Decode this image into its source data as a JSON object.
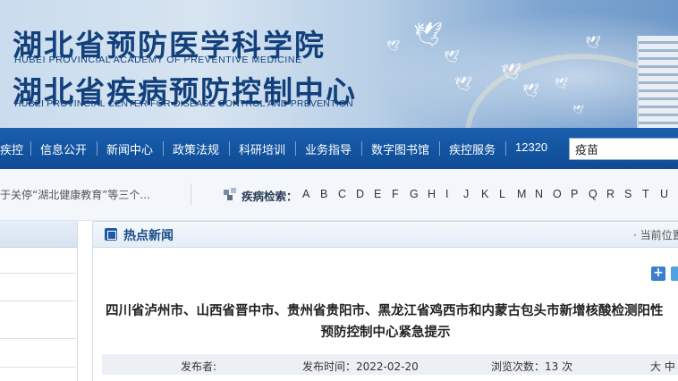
{
  "header": {
    "title_cn_1": "湖北省预防医学科学院",
    "title_en_1": "HUBEI PROVINCIAL ACADEMY OF PREVENTIVE MEDICINE",
    "title_cn_2": "湖北省疾病预防控制中心",
    "title_en_2": "HUBEI PROVINCIAL CENTER FOR DISEASE CONTROL AND PREVENTION"
  },
  "nav": {
    "items": [
      {
        "label": "疾控"
      },
      {
        "label": "信息公开"
      },
      {
        "label": "新闻中心"
      },
      {
        "label": "政策法规"
      },
      {
        "label": "科研培训"
      },
      {
        "label": "业务指导"
      },
      {
        "label": "数字图书馆"
      },
      {
        "label": "疾控服务"
      },
      {
        "label": "12320"
      }
    ],
    "search_value": "疫苗"
  },
  "infobar": {
    "notice": "于关停“湖北健康教育”等三个...",
    "disease_search_label": "疾病检索：",
    "letters": [
      "A",
      "B",
      "C",
      "D",
      "E",
      "F",
      "G",
      "H",
      "I",
      "J",
      "K",
      "L",
      "M",
      "N",
      "O",
      "P",
      "Q",
      "R",
      "S",
      "T",
      "U"
    ]
  },
  "panel": {
    "heading": "热点新闻",
    "breadcrumb": "· 当前位置",
    "article": {
      "title_line1": "四川省泸州市、山西省晋中市、贵州省贵阳市、黑龙江省鸡西市和内蒙古包头市新增核酸检测阳性",
      "title_line2": "预防控制中心紧急提示",
      "publisher_label": "发布者:",
      "publish_time": "发布时间：2022-02-20",
      "views": "浏览次数：13 次",
      "font_size_label": "大  中"
    }
  },
  "colors": {
    "nav_bg": "#1a5fae",
    "title_blue": "#12407c",
    "heading_blue": "#1a4b88"
  }
}
